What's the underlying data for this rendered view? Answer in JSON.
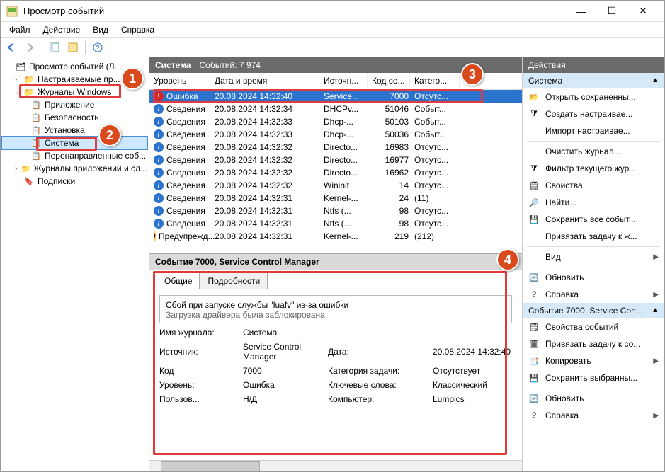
{
  "title": "Просмотр событий",
  "menu": [
    "Файл",
    "Действие",
    "Вид",
    "Справка"
  ],
  "tree": {
    "root": "Просмотр событий (Л...",
    "custom": "Настраиваемые пр...",
    "winlogs": "Журналы Windows",
    "app": "Приложение",
    "security": "Безопасность",
    "setup": "Установка",
    "system": "Система",
    "forwarded": "Перенаправленные соб...",
    "appservices": "Журналы приложений и сл...",
    "subs": "Подписки"
  },
  "centerTitle": "Система",
  "centerCount": "Событий: 7 974",
  "cols": {
    "level": "Уровень",
    "datetime": "Дата и время",
    "source": "Источн...",
    "code": "Код со...",
    "category": "Катего..."
  },
  "rows": [
    {
      "lvl": "err",
      "level": "Ошибка",
      "dt": "20.08.2024 14:32:40",
      "src": "Service...",
      "code": "7000",
      "cat": "Отсутс...",
      "sel": true
    },
    {
      "lvl": "info",
      "level": "Сведения",
      "dt": "20.08.2024 14:32:34",
      "src": "DHCPv...",
      "code": "51046",
      "cat": "Событ..."
    },
    {
      "lvl": "info",
      "level": "Сведения",
      "dt": "20.08.2024 14:32:33",
      "src": "Dhcp-...",
      "code": "50103",
      "cat": "Событ..."
    },
    {
      "lvl": "info",
      "level": "Сведения",
      "dt": "20.08.2024 14:32:33",
      "src": "Dhcp-...",
      "code": "50036",
      "cat": "Событ..."
    },
    {
      "lvl": "info",
      "level": "Сведения",
      "dt": "20.08.2024 14:32:32",
      "src": "Directo...",
      "code": "16983",
      "cat": "Отсутс..."
    },
    {
      "lvl": "info",
      "level": "Сведения",
      "dt": "20.08.2024 14:32:32",
      "src": "Directo...",
      "code": "16977",
      "cat": "Отсутс..."
    },
    {
      "lvl": "info",
      "level": "Сведения",
      "dt": "20.08.2024 14:32:32",
      "src": "Directo...",
      "code": "16962",
      "cat": "Отсутс..."
    },
    {
      "lvl": "info",
      "level": "Сведения",
      "dt": "20.08.2024 14:32:32",
      "src": "Wininit",
      "code": "14",
      "cat": "Отсутс..."
    },
    {
      "lvl": "info",
      "level": "Сведения",
      "dt": "20.08.2024 14:32:31",
      "src": "Kernel-...",
      "code": "24",
      "cat": "(11)"
    },
    {
      "lvl": "info",
      "level": "Сведения",
      "dt": "20.08.2024 14:32:31",
      "src": "Ntfs (...",
      "code": "98",
      "cat": "Отсутс..."
    },
    {
      "lvl": "info",
      "level": "Сведения",
      "dt": "20.08.2024 14:32:31",
      "src": "Ntfs (...",
      "code": "98",
      "cat": "Отсутс..."
    },
    {
      "lvl": "warn",
      "level": "Предупрежд...",
      "dt": "20.08.2024 14:32:31",
      "src": "Kernel-...",
      "code": "219",
      "cat": "(212)"
    }
  ],
  "detailTitle": "Событие 7000, Service Control Manager",
  "tabs": {
    "general": "Общие",
    "details": "Подробности"
  },
  "msg1": "Сбой при запуске службы \"luafv\" из-за ошибки",
  "msg2": "Загрузка драйвера была заблокирована",
  "fields": {
    "logLabel": "Имя журнала:",
    "logVal": "Система",
    "srcLabel": "Источник:",
    "srcVal": "Service Control Manager",
    "dateLabel": "Дата:",
    "dateVal": "20.08.2024 14:32:40",
    "codeLabel": "Код",
    "codeVal": "7000",
    "catLabel": "Категория задачи:",
    "catVal": "Отсутствует",
    "lvlLabel": "Уровень:",
    "lvlVal": "Ошибка",
    "kwLabel": "Ключевые слова:",
    "kwVal": "Классический",
    "userLabel": "Пользов...",
    "userVal": "Н/Д",
    "compLabel": "Компьютер:",
    "compVal": "Lumpics"
  },
  "actionsTitle": "Действия",
  "agroup1": "Система",
  "agroup2": "Событие 7000, Service Con...",
  "a1": [
    "Открыть сохраненны...",
    "Создать настраивае...",
    "Импорт настраивае...",
    "Очистить журнал...",
    "Фильтр текущего жур...",
    "Свойства",
    "Найти...",
    "Сохранить все событ...",
    "Привязать задачу к ж...",
    "Вид",
    "Обновить",
    "Справка"
  ],
  "a2": [
    "Свойства событий",
    "Привязать задачу к со...",
    "Копировать",
    "Сохранить выбранны...",
    "Обновить",
    "Справка"
  ]
}
